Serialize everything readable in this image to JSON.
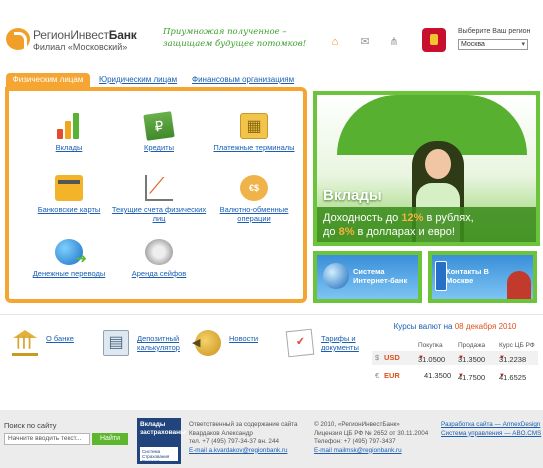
{
  "header": {
    "brand_regular": "РегионИнвест",
    "brand_bold": "Банк",
    "branch": "Филиал «Московский»",
    "slogan_line1": "Приумножая полученное –",
    "slogan_line2": "защищаем будущее потомков!",
    "icons": [
      "home-icon",
      "mail-icon",
      "sitemap-icon"
    ],
    "region": {
      "label": "Выберите Ваш регион",
      "selected": "Москва"
    }
  },
  "tabs": [
    {
      "label": "Физическим лицам",
      "active": true
    },
    {
      "label": "Юридическим лицам",
      "active": false
    },
    {
      "label": "Финансовым организациям",
      "active": false
    }
  ],
  "products": [
    {
      "label": "Вклады",
      "icon": "bar-chart-icon"
    },
    {
      "label": "Кредиты",
      "icon": "money-icon"
    },
    {
      "label": "Платежные терминалы",
      "icon": "terminal-icon"
    },
    {
      "label": "Банковские карты",
      "icon": "card-icon"
    },
    {
      "label": "Текущие счета физических лиц",
      "icon": "growth-chart-icon"
    },
    {
      "label": "Валютно-обменные операции",
      "icon": "currency-exchange-icon"
    },
    {
      "label": "Денежные переводы",
      "icon": "globe-transfer-icon"
    },
    {
      "label": "Аренда сейфов",
      "icon": "safe-icon"
    }
  ],
  "banner": {
    "title": "Вклады",
    "text_1": "Доходность до ",
    "highlight_1": "12%",
    "text_2": " в рублях,",
    "text_3": "до ",
    "highlight_2": "8%",
    "text_4": " в долларах и евро!"
  },
  "small_banners": [
    {
      "label": "Система Интернет-банк"
    },
    {
      "label": "Контакты В Москве"
    }
  ],
  "bottom_links": [
    {
      "label_line1": "О банке",
      "label_line2": ""
    },
    {
      "label_line1": "Депозитный",
      "label_line2": "калькулятор"
    },
    {
      "label_line1": "Новости",
      "label_line2": ""
    },
    {
      "label_line1": "Тарифы и",
      "label_line2": "документы"
    }
  ],
  "currency": {
    "title": "Курсы валют",
    "title_on": " на ",
    "date": "08 декабря 2010",
    "headers": [
      "Покупка",
      "Продажа",
      "Курс ЦБ РФ"
    ],
    "rows": [
      {
        "symbol": "$",
        "code": "USD",
        "buy": "31.0500",
        "sell": "31.3500",
        "cbr": "31.2238"
      },
      {
        "symbol": "€",
        "code": "EUR",
        "buy": "41.3500",
        "sell": "41.7500",
        "cbr": "41.6525"
      }
    ]
  },
  "footer": {
    "search_label": "Поиск по сайту",
    "search_placeholder": "Начните вводить текст...",
    "search_button": "Найти",
    "deposit_line1": "Вклады",
    "deposit_line2": "застрахованы",
    "deposit_sub": "Система Страхования Вкладов",
    "col1": [
      "Ответственный за содержание сайта",
      "Квардаков Александр",
      "тел. +7 (495) 797-34-37 вн. 244",
      "E-mail a.kvardakov@regionbank.ru"
    ],
    "col2": [
      "© 2010, «РегионИнвестБанк»",
      "Лицензия ЦБ РФ № 2652 от 30.11.2004",
      "Телефон: +7 (495) 797-3437",
      "E-mail mailmsk@regionbank.ru"
    ],
    "col3": [
      "Разработка сайта — ArmexDesign",
      "Система управления — ABO.CMS"
    ]
  }
}
